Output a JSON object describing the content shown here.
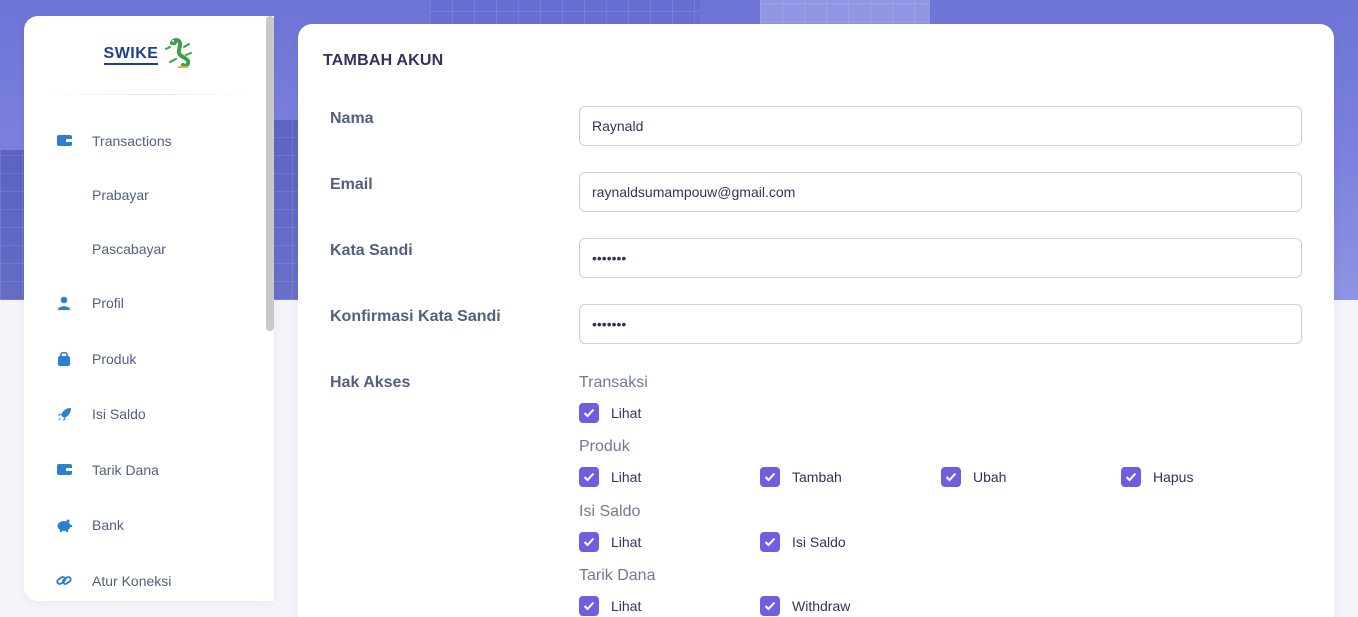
{
  "brand": {
    "name": "SWIKE"
  },
  "sidebar": {
    "items": [
      {
        "label": "Transactions",
        "icon": "wallet-icon"
      },
      {
        "label": "Prabayar",
        "icon": ""
      },
      {
        "label": "Pascabayar",
        "icon": ""
      },
      {
        "label": "Profil",
        "icon": "user-icon"
      },
      {
        "label": "Produk",
        "icon": "bag-icon"
      },
      {
        "label": "Isi Saldo",
        "icon": "rocket-icon"
      },
      {
        "label": "Tarik Dana",
        "icon": "wallet-icon"
      },
      {
        "label": "Bank",
        "icon": "piggy-bank-icon"
      },
      {
        "label": "Atur Koneksi",
        "icon": "link-icon"
      }
    ]
  },
  "form": {
    "title": "TAMBAH AKUN",
    "nama": {
      "label": "Nama",
      "value": "Raynald"
    },
    "email": {
      "label": "Email",
      "value": "raynaldsumampouw@gmail.com"
    },
    "password": {
      "label": "Kata Sandi",
      "value": "1234567"
    },
    "confirm": {
      "label": "Konfirmasi Kata Sandi",
      "value": "1234567"
    },
    "akses": {
      "label": "Hak Akses",
      "groups": [
        {
          "title": "Transaksi",
          "options": [
            {
              "label": "Lihat",
              "checked": true
            }
          ]
        },
        {
          "title": "Produk",
          "options": [
            {
              "label": "Lihat",
              "checked": true
            },
            {
              "label": "Tambah",
              "checked": true
            },
            {
              "label": "Ubah",
              "checked": true
            },
            {
              "label": "Hapus",
              "checked": true
            }
          ]
        },
        {
          "title": "Isi Saldo",
          "options": [
            {
              "label": "Lihat",
              "checked": true
            },
            {
              "label": "Isi Saldo",
              "checked": true
            }
          ]
        },
        {
          "title": "Tarik Dana",
          "options": [
            {
              "label": "Lihat",
              "checked": true
            },
            {
              "label": "Withdraw",
              "checked": true
            }
          ]
        }
      ]
    }
  },
  "colors": {
    "accent": "#6f5ee0",
    "nav_icon": "#2d7fd0",
    "hero": "#7d82de"
  }
}
